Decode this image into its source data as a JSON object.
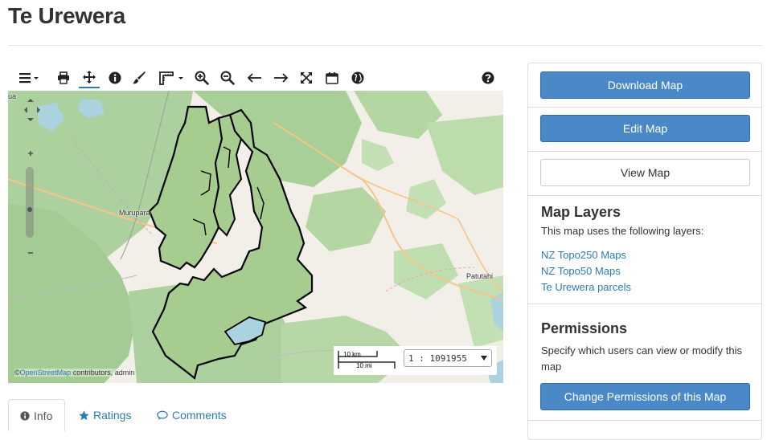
{
  "page": {
    "title": "Te Urewera"
  },
  "toolbar": {
    "icons": [
      "menu-icon",
      "print-icon",
      "pan-icon",
      "info-icon",
      "style-brush-icon",
      "measure-icon",
      "zoom-in-icon",
      "zoom-out-icon",
      "previous-extent-icon",
      "next-extent-icon",
      "full-extent-icon",
      "calendar-icon",
      "globe-icon",
      "help-icon"
    ]
  },
  "map": {
    "labels": {
      "murupara": "Murupara",
      "patutahi": "Patutahi",
      "edge": "ua"
    },
    "attribution": {
      "prefix": "©",
      "osm": "OpenStreetMap",
      "rest": " contributors, admin"
    },
    "scale_bar": {
      "km": "10 km",
      "mi": "10 mi"
    },
    "scale_value": "1 : 1091955",
    "colors": {
      "forest": "#a8cd94",
      "parcel": "#a6cc90",
      "land": "#f2efe9",
      "water": "#aad3df"
    }
  },
  "tabs": [
    {
      "label": "Info",
      "icon": "info-icon"
    },
    {
      "label": "Ratings",
      "icon": "star-icon"
    },
    {
      "label": "Comments",
      "icon": "comment-icon"
    }
  ],
  "sidebar": {
    "download_label": "Download Map",
    "edit_label": "Edit Map",
    "view_label": "View Map",
    "layers": {
      "heading": "Map Layers",
      "intro": "This map uses the following layers:",
      "items": [
        "NZ Topo250 Maps",
        "NZ Topo50 Maps",
        "Te Urewera parcels"
      ]
    },
    "permissions": {
      "heading": "Permissions",
      "text": "Specify which users can view or modify this map",
      "button_label": "Change Permissions of this Map"
    }
  },
  "colors": {
    "accent": "#4a88c8",
    "link": "#2c7bb6"
  }
}
